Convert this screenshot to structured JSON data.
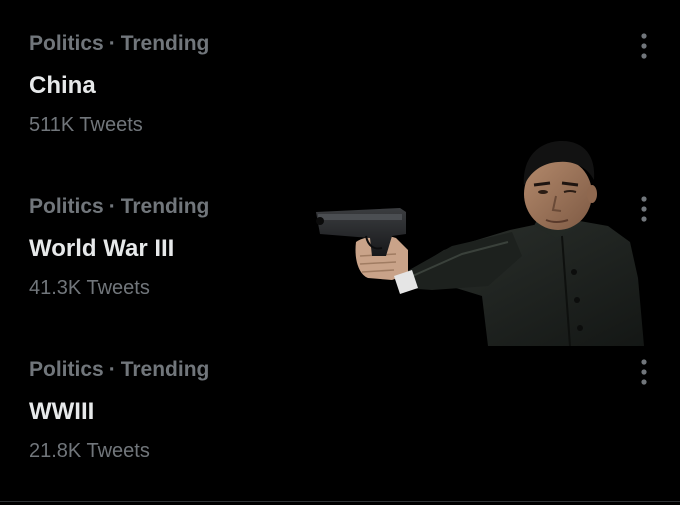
{
  "trends": [
    {
      "category": "Politics",
      "separator": "·",
      "status": "Trending",
      "topic": "China",
      "tweet_count": "511K Tweets"
    },
    {
      "category": "Politics",
      "separator": "·",
      "status": "Trending",
      "topic": "World War III",
      "tweet_count": "41.3K Tweets"
    },
    {
      "category": "Politics",
      "separator": "·",
      "status": "Trending",
      "topic": "WWIII",
      "tweet_count": "21.8K Tweets"
    }
  ],
  "icons": {
    "more": "more-options-icon"
  },
  "colors": {
    "background": "#000000",
    "primary_text": "#e7e9ea",
    "secondary_text": "#71767b"
  }
}
